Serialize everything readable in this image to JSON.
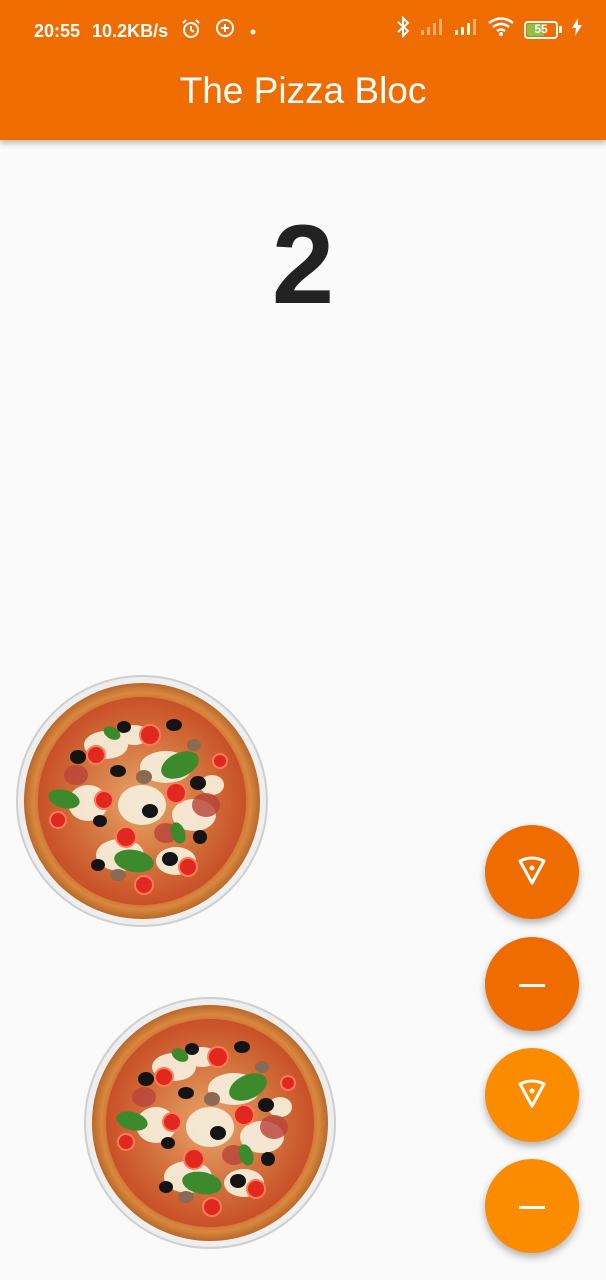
{
  "status_bar": {
    "time": "20:55",
    "speed": "10.2KB/s",
    "battery": "55"
  },
  "app_bar": {
    "title": "The Pizza Bloc"
  },
  "counter": {
    "value": "2"
  },
  "pizzas": {
    "count": 2
  },
  "fabs": [
    {
      "icon": "pizza-slice-icon",
      "action": "add",
      "color": "#ef6c00"
    },
    {
      "icon": "minus-icon",
      "action": "remove",
      "color": "#ef6c00"
    },
    {
      "icon": "pizza-slice-icon",
      "action": "add",
      "color": "#fb8c00"
    },
    {
      "icon": "minus-icon",
      "action": "remove",
      "color": "#fb8c00"
    }
  ],
  "colors": {
    "primary": "#ef6c00",
    "accent": "#fb8c00",
    "background": "#fafafa",
    "text": "#222222"
  }
}
